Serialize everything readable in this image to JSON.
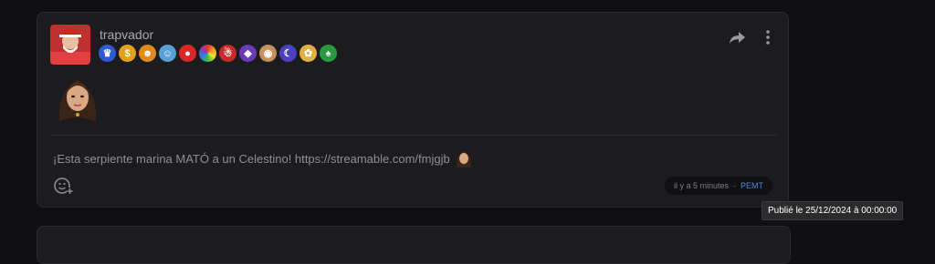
{
  "post": {
    "username": "trapvador",
    "message_text": "¡Esta serpiente marina MATÓ a un Celestino! https://streamable.com/fmjgjb",
    "timestamp": "il y a 5 minutes",
    "separator": "-",
    "timezone": "PEMT"
  },
  "badges": [
    {
      "name": "crown-badge",
      "color": "#2d5bd6",
      "glyph": "♛"
    },
    {
      "name": "dollar-badge",
      "color": "#e0a020",
      "glyph": "$"
    },
    {
      "name": "character-badge-1",
      "color": "#e08a1c",
      "glyph": "☻"
    },
    {
      "name": "character-badge-2",
      "color": "#5aa0d8",
      "glyph": "☺"
    },
    {
      "name": "clown-badge",
      "color": "#d82828",
      "glyph": "●"
    },
    {
      "name": "rainbow-badge",
      "color": "#e8a030",
      "glyph": ""
    },
    {
      "name": "santa-badge",
      "color": "#c82a2a",
      "glyph": "☃"
    },
    {
      "name": "purple-badge",
      "color": "#6a3ab8",
      "glyph": "◆"
    },
    {
      "name": "dog-badge",
      "color": "#c8905a",
      "glyph": "◉"
    },
    {
      "name": "moon-badge",
      "color": "#4a40c0",
      "glyph": "☾"
    },
    {
      "name": "palette-badge",
      "color": "#e0b040",
      "glyph": "✿"
    },
    {
      "name": "cards-badge",
      "color": "#2a9a40",
      "glyph": "♠"
    }
  ],
  "tooltip": {
    "text": "Publié le 25/12/2024 à 00:00:00"
  },
  "icons": {
    "share": "share-icon",
    "more": "more-vertical-icon",
    "react": "add-reaction-icon"
  }
}
